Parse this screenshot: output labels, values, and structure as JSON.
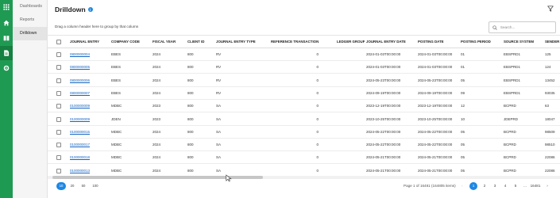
{
  "rail": {
    "items": [
      {
        "name": "apps-grid-icon"
      },
      {
        "name": "home-icon"
      },
      {
        "name": "book-icon"
      },
      {
        "name": "document-icon"
      },
      {
        "name": "settings-icon"
      }
    ]
  },
  "subnav": {
    "items": [
      "Dashboards",
      "Reports",
      "Drilldown"
    ],
    "active_index": 2
  },
  "header": {
    "title": "Drilldown",
    "info_icon": "i",
    "filter_icon": "filter-icon"
  },
  "toolbar": {
    "group_hint": "Drag a column header here to group by that column",
    "search_placeholder": "Search..."
  },
  "grid": {
    "columns": [
      "JOURNAL ENTRY",
      "COMPANY CODE",
      "FISCAL YEAR",
      "CLIENT ID",
      "JOURNAL ENTRY TYPE",
      "REFERENCE TRANSACTION",
      "LEDGER GROUP",
      "JOURNAL ENTRY DATE",
      "POSTING DATE",
      "POSTING PERIOD",
      "SOURCE SYSTEM",
      "SENDER"
    ],
    "rows": [
      [
        "0800000004",
        "EBES",
        "2024",
        "800",
        "RV",
        "0",
        "",
        "2024-01-03T00:00:00",
        "2024-01-03T00:00:00",
        "01",
        "EBSPRD1",
        "125"
      ],
      [
        "0800000005",
        "EBES",
        "2024",
        "800",
        "RV",
        "0",
        "",
        "2024-01-03T00:00:00",
        "2024-01-03T00:00:00",
        "01",
        "EBSPRD1",
        "124"
      ],
      [
        "0800000006",
        "EBES",
        "2024",
        "800",
        "RV",
        "0",
        "",
        "2024-05-23T00:00:00",
        "2024-05-23T00:00:00",
        "05",
        "EBSPRD1",
        "13452"
      ],
      [
        "0800000007",
        "EBES",
        "2024",
        "800",
        "RV",
        "0",
        "",
        "2024-09-19T00:00:00",
        "2024-09-19T00:00:00",
        "09",
        "EBSPRD1",
        "93035"
      ],
      [
        "0100000009",
        "MDBC",
        "2023",
        "800",
        "SA",
        "0",
        "",
        "2023-12-19T00:00:00",
        "2023-12-19T00:00:00",
        "12",
        "BCPRD",
        "63"
      ],
      [
        "0100000009",
        "JDEN",
        "2023",
        "800",
        "SA",
        "0",
        "",
        "2023-10-25T00:00:00",
        "2023-10-25T00:00:00",
        "10",
        "JDEPRD",
        "18047"
      ],
      [
        "0100000015",
        "MDBC",
        "2024",
        "800",
        "SA",
        "0",
        "",
        "2024-05-22T00:00:00",
        "2024-05-22T00:00:00",
        "05",
        "BCPRD",
        "98509"
      ],
      [
        "0100000017",
        "MDBC",
        "2024",
        "800",
        "SA",
        "0",
        "",
        "2024-05-22T00:00:00",
        "2024-05-22T00:00:00",
        "05",
        "BCPRD",
        "98510"
      ],
      [
        "0100000018",
        "MDBC",
        "2024",
        "800",
        "SA",
        "0",
        "",
        "2024-05-21T00:00:00",
        "2024-05-21T00:00:00",
        "05",
        "BCPRD",
        "22086"
      ],
      [
        "0100000013",
        "MDBC",
        "2024",
        "800",
        "SA",
        "0",
        "",
        "2024-05-21T00:00:00",
        "2024-05-21T00:00:00",
        "05",
        "BCPRD",
        "22086"
      ]
    ]
  },
  "pager": {
    "sizes": [
      "10",
      "20",
      "50",
      "100"
    ],
    "active_size_index": 0,
    "info": "Page 1 of 16481 (164805 items)",
    "prev": "‹",
    "next": "›",
    "pages": [
      "1",
      "2",
      "3",
      "4",
      "5",
      "...",
      "16481"
    ],
    "active_page_index": 0
  },
  "colors": {
    "rail_bg": "#1f9a53",
    "accent": "#1e88e5",
    "link": "#1565c0"
  }
}
